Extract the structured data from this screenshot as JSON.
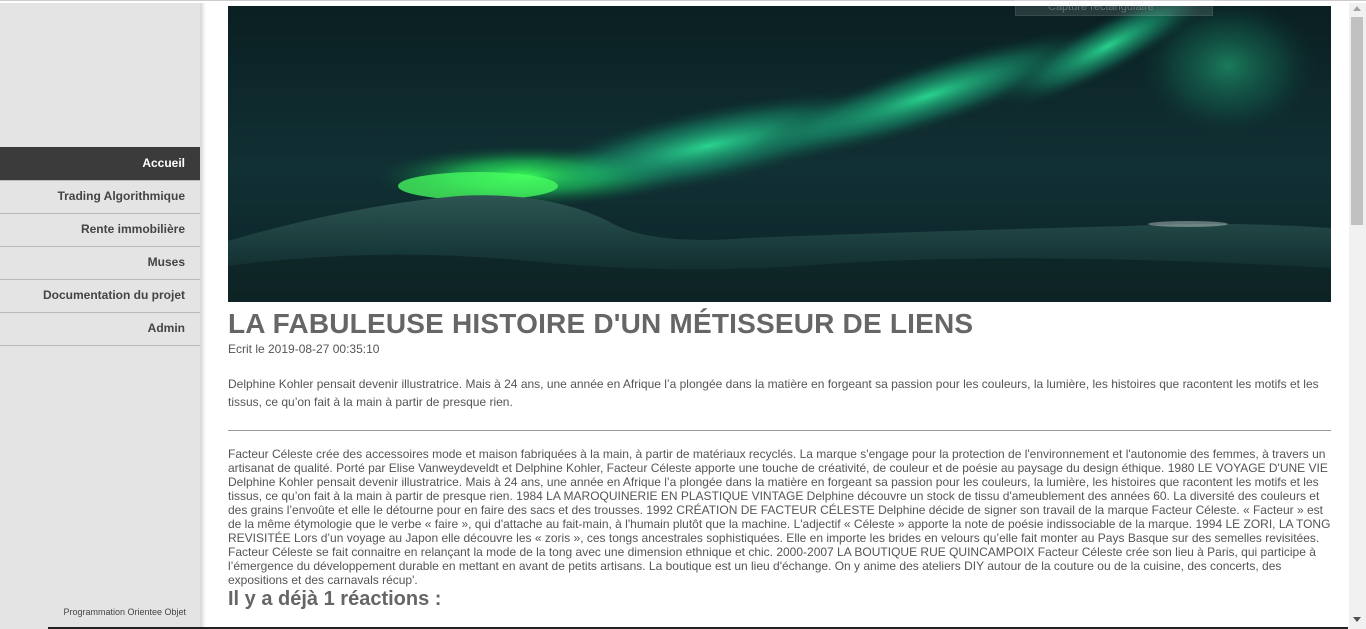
{
  "sidebar": {
    "items": [
      {
        "label": "Accueil",
        "active": true
      },
      {
        "label": "Trading Algorithmique",
        "active": false
      },
      {
        "label": "Rente immobilière",
        "active": false
      },
      {
        "label": "Muses",
        "active": false
      },
      {
        "label": "Documentation du projet",
        "active": false
      },
      {
        "label": "Admin",
        "active": false
      }
    ],
    "footer": "Programmation Orientee Objet"
  },
  "hero": {
    "overlay_text": "Capture rectangulaire"
  },
  "article": {
    "title": "LA FABULEUSE HISTOIRE D'UN MÉTISSEUR DE LIENS",
    "date": "Ecrit le 2019-08-27 00:35:10",
    "intro": "Delphine Kohler pensait devenir illustratrice. Mais à 24 ans, une année en Afrique l’a plongée dans la matière en forgeant sa passion pour les couleurs, la lumière, les histoires que racontent les motifs et les tissus, ce qu’on fait à la main à partir de presque rien.",
    "body": "Facteur Céleste crée des accessoires mode et maison fabriquées à la main, à partir de matériaux recyclés. La marque s'engage pour la protection de l'environnement et l'autonomie des femmes, à travers un artisanat de qualité. Porté par Elise Vanweydeveldt et Delphine Kohler, Facteur Céleste apporte une touche de créativité, de couleur et de poésie au paysage du design éthique. 1980 LE VOYAGE D'UNE VIE Delphine Kohler pensait devenir illustratrice. Mais à 24 ans, une année en Afrique l’a plongée dans la matière en forgeant sa passion pour les couleurs, la lumière, les histoires que racontent les motifs et les tissus, ce qu’on fait à la main à partir de presque rien. 1984 LA MAROQUINERIE EN PLASTIQUE VINTAGE Delphine découvre un stock de tissu d'ameublement des années 60. La diversité des couleurs et des grains l’envoûte et elle le détourne pour en faire des sacs et des trousses. 1992 CRÉATION DE FACTEUR CÉLESTE Delphine décide de signer son travail de la marque Facteur Céleste. « Facteur » est de la même étymologie que le verbe « faire », qui d'attache au fait-main, à l'humain plutôt que la machine. L'adjectif « Céleste » apporte la note de poésie indissociable de la marque. 1994 LE ZORI, LA TONG REVISITÉE Lors d’un voyage au Japon elle découvre les « zoris », ces tongs ancestrales sophistiquées. Elle en importe les brides en velours qu’elle fait monter au Pays Basque sur des semelles revisitées. Facteur Céleste se fait connaitre en relançant la mode de la tong avec une dimension ethnique et chic. 2000-2007 LA BOUTIQUE RUE QUINCAMPOIX Facteur Céleste crée son lieu à Paris, qui participe à l’émergence du développement durable en mettant en avant de petits artisans. La boutique est un lieu d'échange. On y anime des ateliers DIY autour de la couture ou de la cuisine, des concerts, des expositions et des carnavals récup'.",
    "reactions": "Il y a déjà 1 réactions :"
  }
}
